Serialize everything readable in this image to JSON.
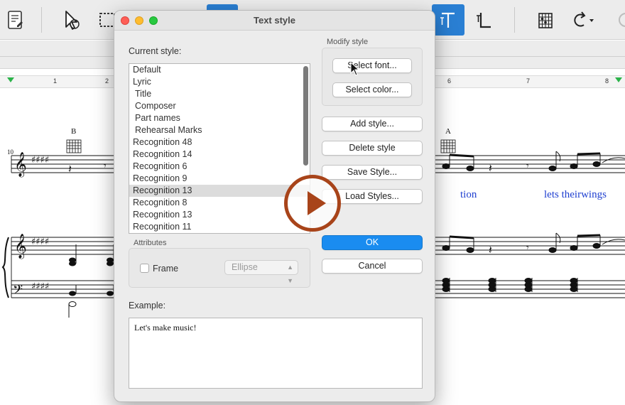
{
  "dialog": {
    "title": "Text style",
    "current_style_label": "Current style:",
    "styles": [
      "Default",
      "Lyric",
      "Title",
      "Composer",
      "Part names",
      "Rehearsal Marks",
      "Recognition 48",
      "Recognition 14",
      "Recognition 6",
      "Recognition 9",
      "Recognition 13",
      "Recognition 8",
      "Recognition 13",
      "Recognition 11"
    ],
    "selected_style": "Recognition 13",
    "modify_style_label": "Modify style",
    "select_font_button": "Select font...",
    "select_color_button": "Select color...",
    "add_style_button": "Add style...",
    "delete_style_button": "Delete style",
    "save_style_button": "Save Style...",
    "load_styles_button": "Load Styles...",
    "ok_button": "OK",
    "cancel_button": "Cancel",
    "attributes_label": "Attributes",
    "frame_label": "Frame",
    "frame_checked": false,
    "frame_shape_value": "Ellipse",
    "example_label": "Example:",
    "example_text": "Let's make music!"
  },
  "score": {
    "ruler_numbers": [
      "1",
      "2",
      "6",
      "7",
      "8"
    ],
    "measure_number": "10",
    "chord_names": [
      "B",
      "A"
    ],
    "lyrics": [
      "tion",
      "lets theirwings"
    ]
  },
  "toolbar": {
    "icons": [
      "document-icon",
      "pointer-tool-icon",
      "select-rectangle-icon",
      "text-tool-icon",
      "lyric-tool-icon",
      "chord-grid-icon",
      "undo-icon"
    ]
  },
  "colors": {
    "accent": "#1a8cf0",
    "lyric_text": "#1f3fd0",
    "play_overlay": "#a8441a"
  }
}
